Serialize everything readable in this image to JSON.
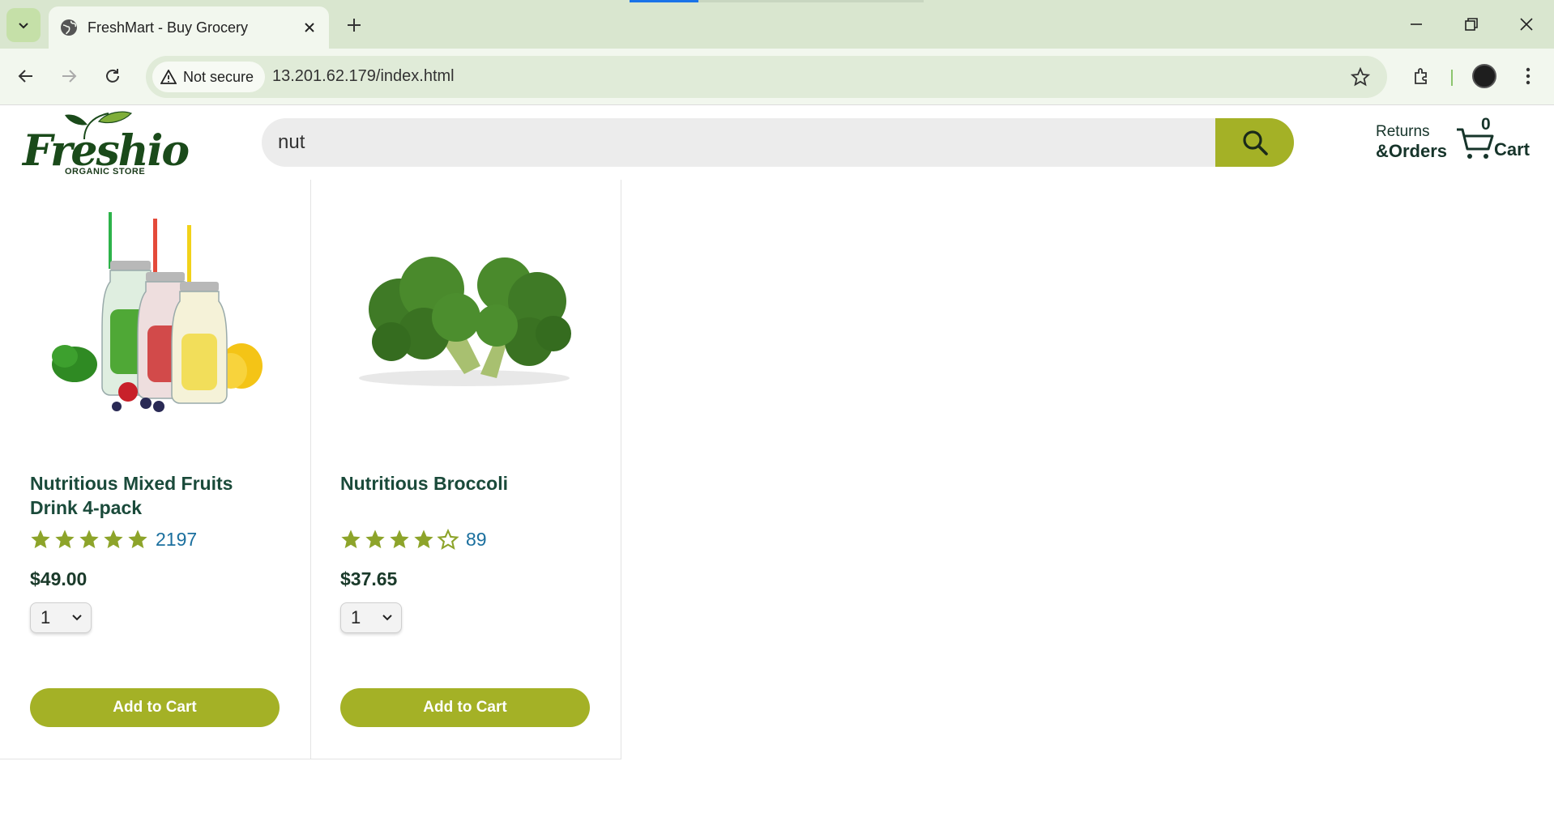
{
  "browser": {
    "tab_title": "FreshMart - Buy Grocery",
    "security_label": "Not secure",
    "url": "13.201.62.179/index.html"
  },
  "header": {
    "logo_word": "Freshio",
    "logo_tagline": "ORGANIC STORE",
    "search_value": "nut",
    "returns_line1": "Returns",
    "returns_line2": "&Orders",
    "cart_count": "0",
    "cart_label": "Cart"
  },
  "products": [
    {
      "name": "Nutritious Mixed Fruits Drink 4-pack",
      "rating": 5,
      "rating_count": "2197",
      "price": "$49.00",
      "qty": "1",
      "add_label": "Add to Cart"
    },
    {
      "name": "Nutritious Broccoli",
      "rating": 4,
      "rating_count": "89",
      "price": "$37.65",
      "qty": "1",
      "add_label": "Add to Cart"
    }
  ],
  "colors": {
    "accent": "#a4b126",
    "heading": "#1a4a3a",
    "link": "#1a6f9e"
  }
}
